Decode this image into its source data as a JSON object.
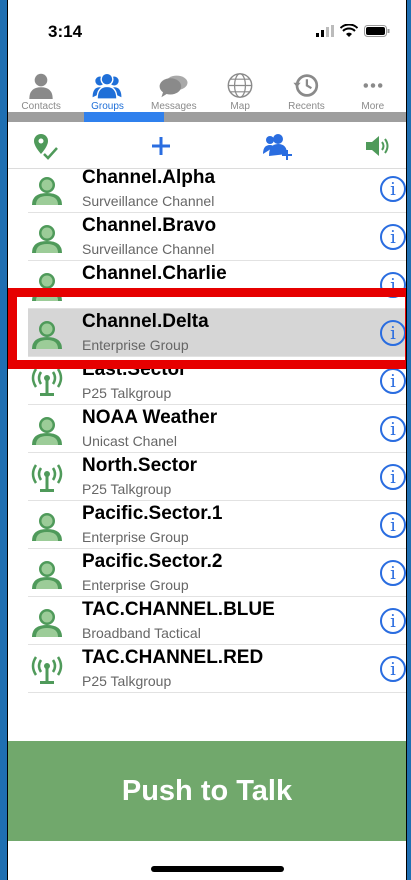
{
  "status": {
    "time": "3:14"
  },
  "tabs": [
    {
      "label": "Contacts",
      "icon": "person-icon"
    },
    {
      "label": "Groups",
      "icon": "group-icon",
      "active": true
    },
    {
      "label": "Messages",
      "icon": "messages-icon"
    },
    {
      "label": "Map",
      "icon": "globe-icon"
    },
    {
      "label": "Recents",
      "icon": "recents-icon"
    },
    {
      "label": "More",
      "icon": "more-icon"
    }
  ],
  "toolbar": {
    "items": [
      "location-check-icon",
      "add-icon",
      "add-group-icon",
      "speaker-icon"
    ]
  },
  "groups": [
    {
      "name": "Channel.Alpha",
      "sub": "Surveillance Channel",
      "type": "group"
    },
    {
      "name": "Channel.Bravo",
      "sub": "Surveillance Channel",
      "type": "group"
    },
    {
      "name": "Channel.Charlie",
      "sub": "",
      "type": "group"
    },
    {
      "name": "Channel.Delta",
      "sub": "Enterprise Group",
      "type": "group",
      "selected": true
    },
    {
      "name": "East.Sector",
      "sub": "P25 Talkgroup",
      "type": "radio"
    },
    {
      "name": "NOAA Weather",
      "sub": "Unicast Chanel",
      "type": "group"
    },
    {
      "name": "North.Sector",
      "sub": "P25 Talkgroup",
      "type": "radio"
    },
    {
      "name": "Pacific.Sector.1",
      "sub": "Enterprise Group",
      "type": "group"
    },
    {
      "name": "Pacific.Sector.2",
      "sub": "Enterprise Group",
      "type": "group"
    },
    {
      "name": "TAC.CHANNEL.BLUE",
      "sub": "Broadband Tactical",
      "type": "group"
    },
    {
      "name": "TAC.CHANNEL.RED",
      "sub": "P25 Talkgroup",
      "type": "radio"
    }
  ],
  "info_glyph": "i",
  "ptt_label": "Push to Talk",
  "colors": {
    "accent": "#2a6de0",
    "ptt": "#71a86c",
    "highlight": "#e60000",
    "icon_green": "#4f9a5a"
  }
}
